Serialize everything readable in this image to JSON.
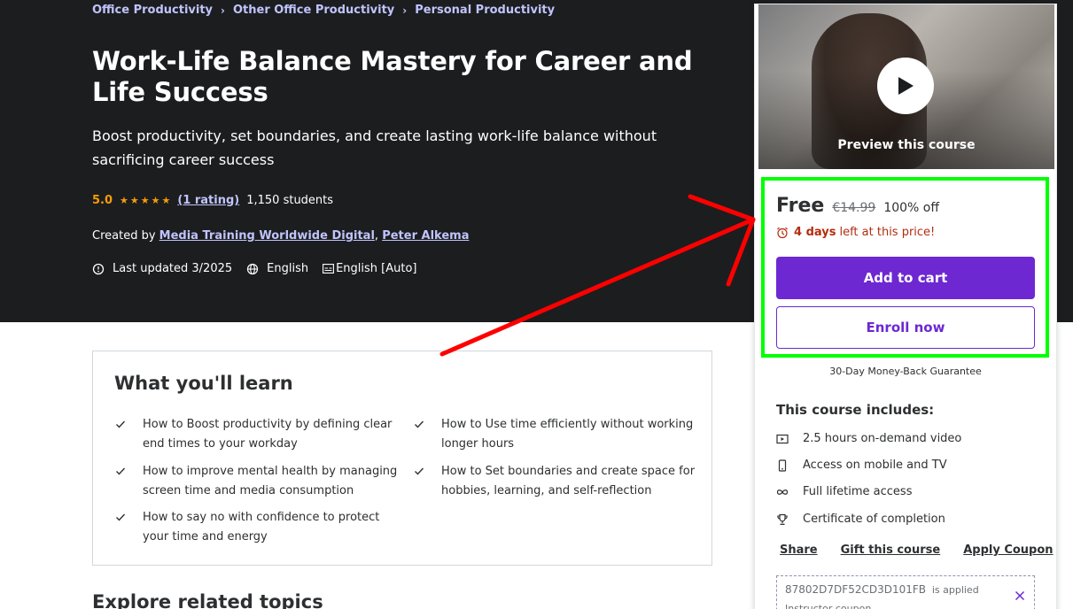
{
  "breadcrumb": [
    "Office Productivity",
    "Other Office Productivity",
    "Personal Productivity"
  ],
  "course": {
    "title": "Work-Life Balance Mastery for Career and Life Success",
    "subtitle": "Boost productivity, set boundaries, and create lasting work-life balance without sacrificing career success",
    "rating": "5.0",
    "stars": "★★★★★",
    "rating_count": "(1 rating)",
    "students": "1,150 students",
    "created_by_label": "Created by",
    "instructors": [
      "Media Training Worldwide Digital",
      "Peter Alkema"
    ],
    "instructor_sep": ",",
    "last_updated": "Last updated 3/2025",
    "language": "English",
    "captions": "English [Auto]"
  },
  "learn": {
    "title": "What you'll learn",
    "items": [
      "How to Boost productivity by defining clear end times to your workday",
      "How to Use time efficiently without working longer hours",
      "How to improve mental health by managing screen time and media consumption",
      "How to Set boundaries and create space for hobbies, learning, and self-reflection",
      "How to say no with confidence to protect your time and energy"
    ]
  },
  "explore_title": "Explore related topics",
  "sidebar": {
    "preview_label": "Preview this course",
    "price": "Free",
    "old_price": "€14.99",
    "discount": "100% off",
    "timer_bold": "4 days",
    "timer_rest": "left at this price!",
    "add_to_cart": "Add to cart",
    "enroll_now": "Enroll now",
    "guarantee": "30-Day Money-Back Guarantee",
    "includes_title": "This course includes:",
    "includes": [
      "2.5 hours on-demand video",
      "Access on mobile and TV",
      "Full lifetime access",
      "Certificate of completion"
    ],
    "links": [
      "Share",
      "Gift this course",
      "Apply Coupon"
    ],
    "coupon_code": "87802D7DF52CD3D101FB",
    "coupon_applied": "is applied",
    "coupon_type": "Instructor coupon"
  },
  "colors": {
    "hero_bg": "#1c1d1f",
    "link": "#c0c4fc",
    "star": "#f69c08",
    "primary": "#6d28d2",
    "timer": "#b32d0f",
    "highlight": "#00ff00",
    "annotation_arrow": "#ff0000"
  },
  "icons": {
    "breadcrumb_separator": "chevron-right-icon",
    "last_updated": "alert-badge-icon",
    "language": "globe-icon",
    "captions": "captions-icon",
    "learn_bullet": "check-icon",
    "preview": "play-icon",
    "timer": "alarm-icon",
    "includes": [
      "video-icon",
      "mobile-icon",
      "infinity-icon",
      "trophy-icon"
    ],
    "coupon_remove": "close-icon"
  }
}
